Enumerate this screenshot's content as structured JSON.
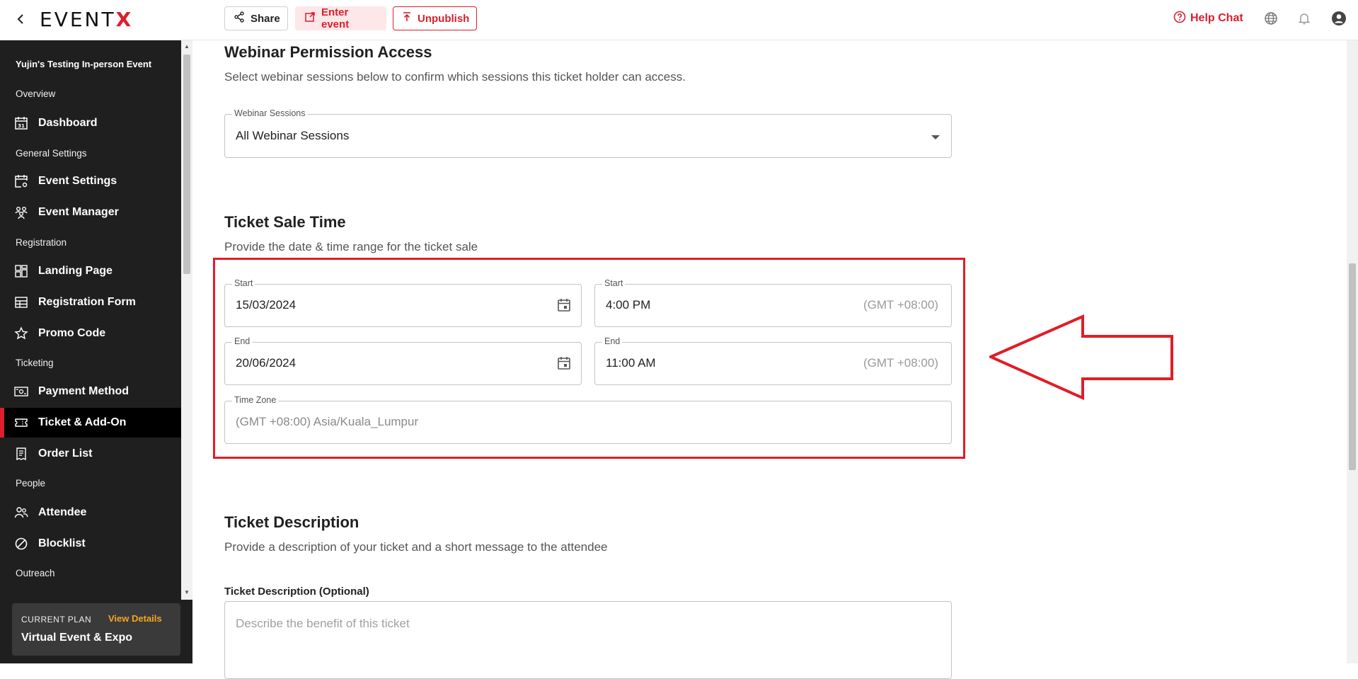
{
  "topbar": {
    "logo_text": "EVENT",
    "logo_x": "X",
    "share_label": "Share",
    "enter_label": "Enter event",
    "unpublish_label": "Unpublish",
    "help_label": "Help Chat"
  },
  "sidebar": {
    "event_name": "Yujin's Testing In-person Event",
    "sections": {
      "overview": "Overview",
      "general": "General Settings",
      "registration": "Registration",
      "ticketing": "Ticketing",
      "people": "People",
      "outreach": "Outreach"
    },
    "items": {
      "dashboard": "Dashboard",
      "event_settings": "Event Settings",
      "event_manager": "Event Manager",
      "landing_page": "Landing Page",
      "registration_form": "Registration Form",
      "promo_code": "Promo Code",
      "payment_method": "Payment Method",
      "ticket_addon": "Ticket & Add-On",
      "order_list": "Order List",
      "attendee": "Attendee",
      "blocklist": "Blocklist"
    },
    "plan": {
      "label": "CURRENT PLAN",
      "link": "View Details",
      "name": "Virtual Event & Expo"
    }
  },
  "webinar": {
    "title": "Webinar Permission Access",
    "subtitle": "Select webinar sessions below to confirm which sessions this ticket holder can access.",
    "field_label": "Webinar Sessions",
    "field_value": "All Webinar Sessions"
  },
  "sale_time": {
    "title": "Ticket Sale Time",
    "subtitle": "Provide the date & time range for the ticket sale",
    "start_date_label": "Start",
    "start_date": "15/03/2024",
    "start_time_label": "Start",
    "start_time": "4:00 PM",
    "end_date_label": "End",
    "end_date": "20/06/2024",
    "end_time_label": "End",
    "end_time": "11:00 AM",
    "gmt": "(GMT +08:00)",
    "tz_label": "Time Zone",
    "tz_value": "(GMT +08:00) Asia/Kuala_Lumpur"
  },
  "description": {
    "title": "Ticket Description",
    "subtitle": "Provide a description of your ticket and a short message to the attendee",
    "field_label": "Ticket Description (Optional)",
    "placeholder": "Describe the benefit of this ticket"
  },
  "colors": {
    "accent": "#dc1e2d",
    "sidebar_bg": "#1f1f1f",
    "plan_link": "#f5a623"
  }
}
